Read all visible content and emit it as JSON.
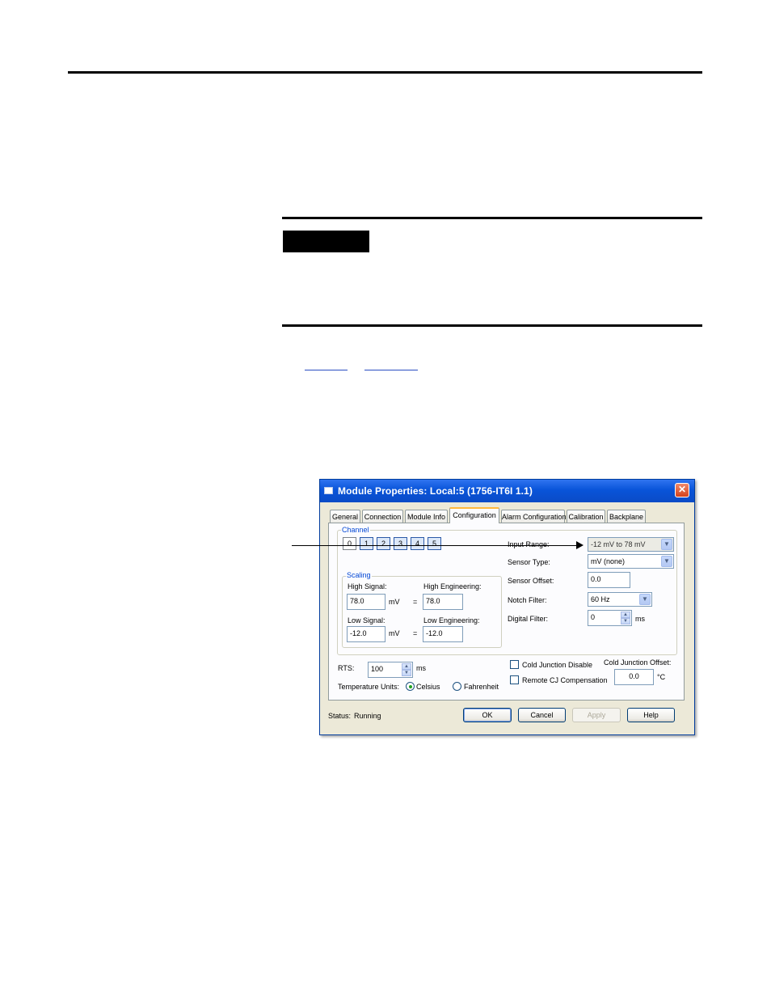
{
  "dialog": {
    "title": "Module Properties: Local:5 (1756-IT6I 1.1)",
    "close_glyph": "✕",
    "tabs": [
      {
        "label": "General"
      },
      {
        "label": "Connection"
      },
      {
        "label": "Module Info"
      },
      {
        "label": "Configuration"
      },
      {
        "label": "Alarm Configuration"
      },
      {
        "label": "Calibration"
      },
      {
        "label": "Backplane"
      }
    ],
    "active_tab": "Configuration",
    "channel": {
      "group_label": "Channel",
      "buttons": [
        "0",
        "1",
        "2",
        "3",
        "4",
        "5"
      ],
      "selected": "0"
    },
    "scaling": {
      "group_label": "Scaling",
      "high_signal_label": "High Signal:",
      "high_signal_value": "78.0",
      "high_signal_unit": "mV",
      "equals": "=",
      "high_engineering_label": "High Engineering:",
      "high_engineering_value": "78.0",
      "low_signal_label": "Low Signal:",
      "low_signal_value": "-12.0",
      "low_signal_unit": "mV",
      "low_engineering_label": "Low Engineering:",
      "low_engineering_value": "-12.0"
    },
    "input_range": {
      "label": "Input Range:",
      "value": "-12 mV to 78 mV"
    },
    "sensor_type": {
      "label": "Sensor Type:",
      "value": "mV (none)"
    },
    "sensor_offset": {
      "label": "Sensor Offset:",
      "value": "0.0"
    },
    "notch_filter": {
      "label": "Notch Filter:",
      "value": "60 Hz"
    },
    "digital_filter": {
      "label": "Digital Filter:",
      "value": "0",
      "unit": "ms"
    },
    "rts": {
      "label": "RTS:",
      "value": "100",
      "unit": "ms"
    },
    "temperature_units": {
      "label": "Temperature Units:",
      "options": [
        "Celsius",
        "Fahrenheit"
      ],
      "selected": "Celsius"
    },
    "cold_junction_disable": {
      "label": "Cold Junction Disable",
      "checked": false
    },
    "remote_cj_compensation": {
      "label": "Remote CJ Compensation",
      "checked": false
    },
    "cold_junction_offset": {
      "label": "Cold Junction Offset:",
      "value": "0.0",
      "unit": "°C"
    },
    "status": {
      "label": "Status:",
      "value": "Running"
    },
    "buttons": {
      "ok": "OK",
      "cancel": "Cancel",
      "apply": "Apply",
      "help": "Help"
    }
  },
  "colors": {
    "titlebar": "#0a4bc6",
    "active_tab_highlight": "#ffb83d",
    "group_title": "#0046d5",
    "window_bg": "#ece9d8"
  }
}
